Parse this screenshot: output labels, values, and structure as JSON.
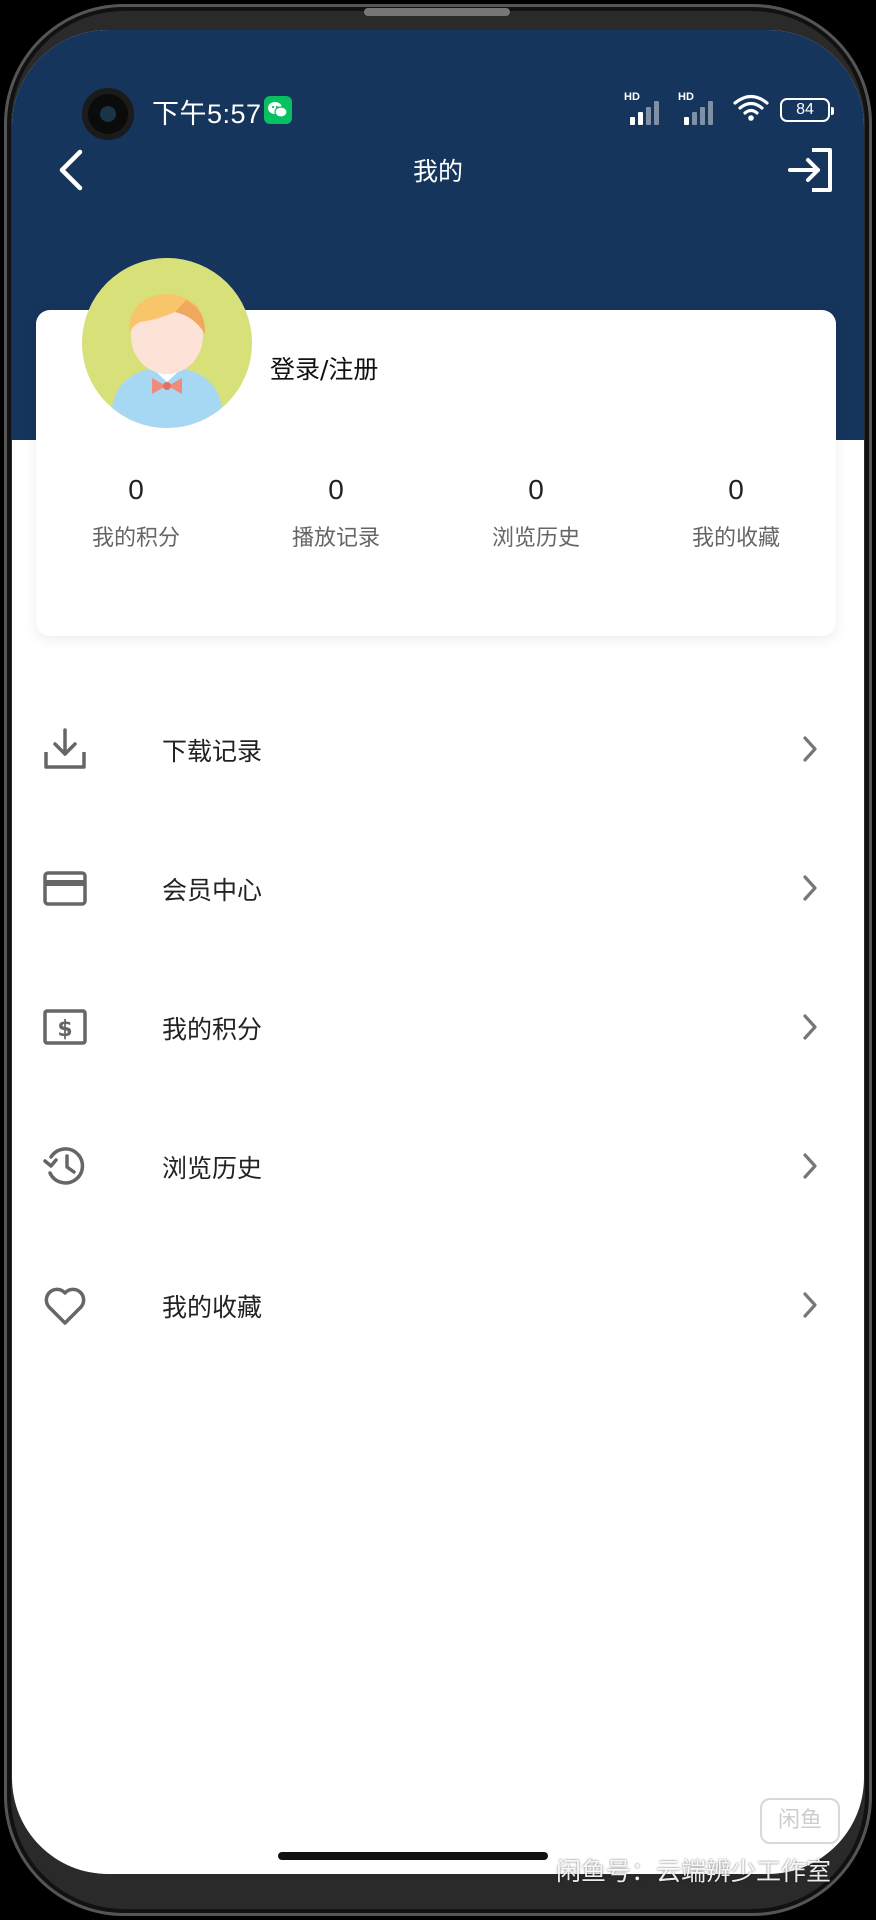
{
  "status_bar": {
    "time": "下午5:57",
    "network_label_1": "HD",
    "network_label_2": "HD",
    "battery": "84",
    "icons": [
      "wechat-icon",
      "signal-icon",
      "signal-icon",
      "wifi-icon",
      "battery-icon"
    ]
  },
  "nav": {
    "title": "我的",
    "back_icon": "chevron-left-icon",
    "logout_icon": "logout-icon"
  },
  "profile": {
    "login_label": "登录/注册",
    "stats": [
      {
        "value": "0",
        "label": "我的积分"
      },
      {
        "value": "0",
        "label": "播放记录"
      },
      {
        "value": "0",
        "label": "浏览历史"
      },
      {
        "value": "0",
        "label": "我的收藏"
      }
    ]
  },
  "menu": {
    "items": [
      {
        "label": "下载记录",
        "icon": "download-icon"
      },
      {
        "label": "会员中心",
        "icon": "card-icon"
      },
      {
        "label": "我的积分",
        "icon": "points-icon"
      },
      {
        "label": "浏览历史",
        "icon": "history-icon"
      },
      {
        "label": "我的收藏",
        "icon": "heart-icon"
      }
    ],
    "arrow_icon": "chevron-right-icon"
  },
  "watermark": {
    "logo": "闲鱼",
    "text": "闲鱼号：云端辨少工作室"
  },
  "colors": {
    "header": "#16355c",
    "background": "#ffffff",
    "text": "#222222",
    "muted": "#666666",
    "icon": "#666666"
  }
}
